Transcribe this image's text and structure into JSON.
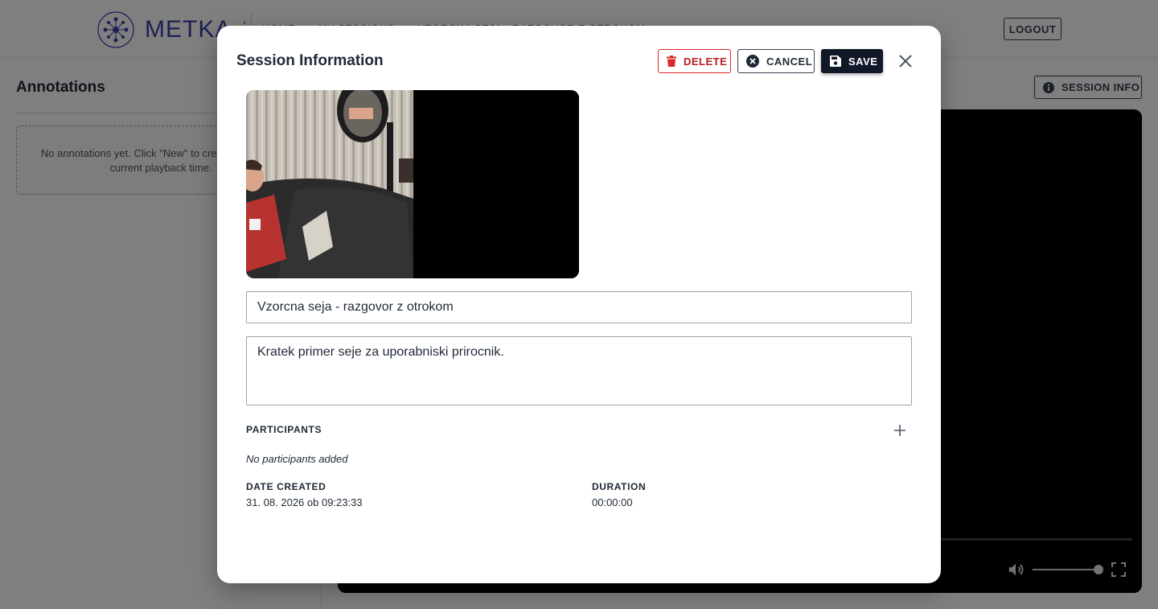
{
  "app": {
    "logo_text": "METKA",
    "breadcrumb": [
      "HOME",
      "MY SESSIONS",
      "VZORCNA SEJA - RAZGOVOR Z OTROKOM"
    ],
    "logout_label": "LOGOUT"
  },
  "annotations": {
    "title": "Annotations",
    "empty_text": "No annotations yet. Click \"New\" to create one at the current playback time."
  },
  "player": {
    "session_info_label": "SESSION INFO",
    "volume_level": 1.0
  },
  "modal": {
    "title": "Session Information",
    "delete_label": "DELETE",
    "cancel_label": "CANCEL",
    "save_label": "SAVE",
    "name_value": "Vzorcna seja - razgovor z otrokom",
    "description_value": "Kratek primer seje za uporabniski prirocnik.",
    "participants_label": "PARTICIPANTS",
    "no_participants_text": "No participants added",
    "date_created_label": "DATE CREATED",
    "date_created_value": "31. 08. 2026 ob 09:23:33",
    "duration_label": "DURATION",
    "duration_value": "00:00:00"
  },
  "icons": {
    "delete": "trash-icon",
    "cancel": "x-circle-icon",
    "save": "floppy-disk-icon",
    "close": "close-icon",
    "add": "plus-icon",
    "info": "info-icon",
    "volume": "volume-icon",
    "fullscreen": "fullscreen-icon"
  },
  "colors": {
    "brand": "#3b3fa8",
    "danger": "#dc2626",
    "primary_button": "#111827"
  }
}
